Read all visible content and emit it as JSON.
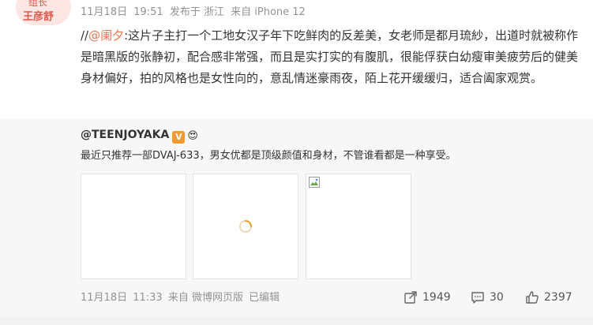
{
  "badge": {
    "top_text": "组长",
    "name": "王彦舒"
  },
  "post": {
    "date": "11月18日",
    "time": "19:51",
    "location": "发布于 浙江",
    "source": "来自 iPhone 12",
    "text_prefix": "//",
    "mention": "@阑夕",
    "text": ":这片子主打一个工地女汉子年下吃鲜肉的反差美，女老师是都月琉紗，出道时就被称作是暗黑版的张静初，配合感非常强，而且是实打实的有腹肌，很能俘获白幼瘦审美疲劳后的健美身材偏好，拍的风格也是女性向的，意乱情迷豪雨夜，陌上花开缓缓归，适合阖家观赏。"
  },
  "repost": {
    "username": "@TEENJOYAKA",
    "verified_badge": "V",
    "emoji": "😍",
    "text": "最近只推荐一部DVAJ-633，男女优都是顶级颜值和身材，不管谁看都是一种享受。",
    "footer": {
      "date": "11月18日",
      "time": "11:33",
      "source": "来自 微博网页版",
      "edited": "已编辑"
    },
    "actions": {
      "share_count": "1949",
      "comment_count": "30",
      "like_count": "2397"
    }
  },
  "colors": {
    "mention": "#eb7350",
    "meta_gray": "#939393",
    "repost_bg": "#f7f7f7",
    "verified": "#f29a2e",
    "badge_red": "#e2574c"
  },
  "icons": {
    "loading": "loading-spinner-icon",
    "broken_image": "broken-image-icon",
    "share": "share-icon",
    "comment": "comment-icon",
    "like": "thumbs-up-icon"
  }
}
